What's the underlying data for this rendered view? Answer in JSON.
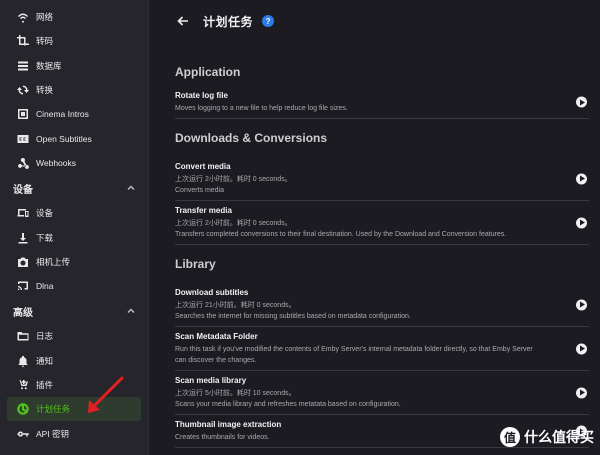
{
  "sidebar": {
    "items_top": [
      {
        "label": "网络",
        "icon": "wifi-icon"
      },
      {
        "label": "转码",
        "icon": "crop-icon"
      },
      {
        "label": "数据库",
        "icon": "database-icon"
      },
      {
        "label": "转换",
        "icon": "sync-icon"
      },
      {
        "label": "Cinema Intros",
        "icon": "film-icon"
      },
      {
        "label": "Open Subtitles",
        "icon": "closed-caption-icon"
      },
      {
        "label": "Webhooks",
        "icon": "webhook-icon"
      }
    ],
    "section_devices": "设备",
    "items_devices": [
      {
        "label": "设备",
        "icon": "devices-icon"
      },
      {
        "label": "下载",
        "icon": "download-icon"
      },
      {
        "label": "相机上传",
        "icon": "camera-icon"
      },
      {
        "label": "Dlna",
        "icon": "cast-icon"
      }
    ],
    "section_advanced": "高级",
    "items_advanced": [
      {
        "label": "日志",
        "icon": "folder-icon"
      },
      {
        "label": "通知",
        "icon": "bell-icon"
      },
      {
        "label": "插件",
        "icon": "plugin-cart-icon"
      },
      {
        "label": "计划任务",
        "icon": "clock-icon",
        "active": true
      },
      {
        "label": "API 密钥",
        "icon": "key-icon"
      }
    ]
  },
  "header": {
    "title": "计划任务",
    "help": "?"
  },
  "groups": [
    {
      "title": "Application",
      "tasks": [
        {
          "name": "Rotate log file",
          "lines": [
            "Moves logging to a new file to help reduce log file sizes."
          ]
        }
      ]
    },
    {
      "title": "Downloads & Conversions",
      "tasks": [
        {
          "name": "Convert media",
          "lines": [
            "上次运行 2小时前。耗时 0 seconds。",
            "Converts media"
          ]
        },
        {
          "name": "Transfer media",
          "lines": [
            "上次运行 2小时前。耗时 0 seconds。",
            "Transfers completed conversions to their final destination. Used by the Download and Conversion features."
          ]
        }
      ]
    },
    {
      "title": "Library",
      "tasks": [
        {
          "name": "Download subtitles",
          "lines": [
            "上次运行 21小时前。耗时 0 seconds。",
            "Searches the internet for missing subtitles based on metadata configuration."
          ]
        },
        {
          "name": "Scan Metadata Folder",
          "lines": [
            "Run this task if you've modified the contents of Emby Server's internal metadata folder directly, so that Emby Server",
            "can discover the changes."
          ]
        },
        {
          "name": "Scan media library",
          "lines": [
            "上次运行 5小时前。耗时 10 seconds。",
            "Scans your media library and refreshes metatata based on configuration."
          ]
        },
        {
          "name": "Thumbnail image extraction",
          "lines": [
            "Creates thumbnails for videos."
          ]
        }
      ]
    }
  ],
  "watermark": {
    "badge": "值",
    "text": "什么值得买"
  },
  "colors": {
    "accent": "#52c41a",
    "annotation_arrow": "#e02020",
    "help": "#2d7be5"
  }
}
